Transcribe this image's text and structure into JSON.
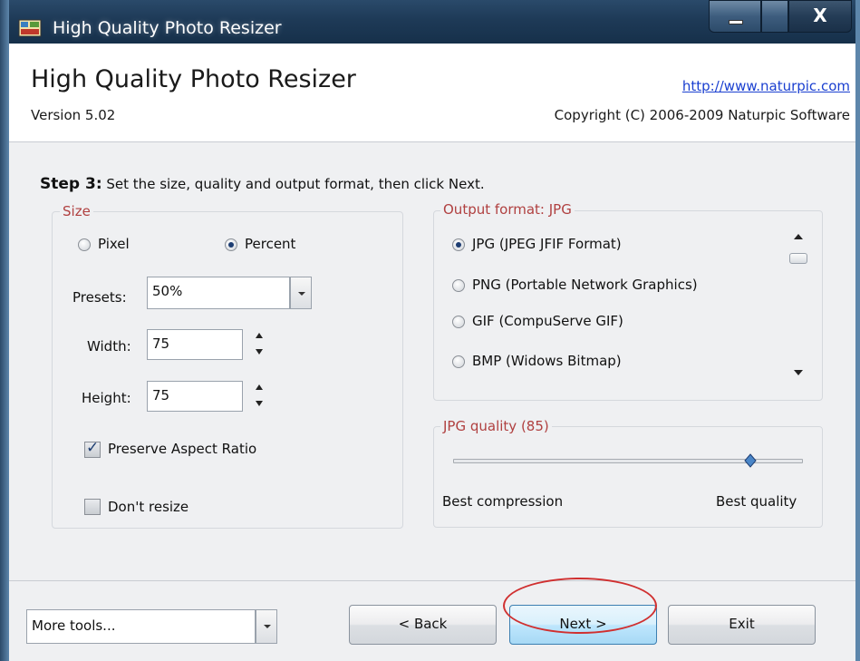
{
  "window": {
    "title": "High Quality Photo Resizer",
    "close_glyph": "X"
  },
  "header": {
    "app_title": "High Quality Photo Resizer",
    "version": "Version 5.02",
    "url": "http://www.naturpic.com",
    "copyright": "Copyright (C) 2006-2009 Naturpic Software"
  },
  "step": {
    "label": "Step 3:",
    "instruction": "Set the size, quality and output format, then click Next."
  },
  "size": {
    "legend": "Size",
    "unit_options": [
      {
        "label": "Pixel",
        "selected": false
      },
      {
        "label": "Percent",
        "selected": true
      }
    ],
    "presets_label": "Presets:",
    "presets_value": "50%",
    "width_label": "Width:",
    "width_value": "75",
    "height_label": "Height:",
    "height_value": "75",
    "preserve_label": "Preserve Aspect Ratio",
    "preserve_checked": true,
    "dont_resize_label": "Don't resize",
    "dont_resize_checked": false
  },
  "output_format": {
    "legend": "Output format: JPG",
    "options": [
      {
        "label": "JPG (JPEG JFIF Format)",
        "selected": true
      },
      {
        "label": "PNG (Portable Network Graphics)",
        "selected": false
      },
      {
        "label": "GIF (CompuServe GIF)",
        "selected": false
      },
      {
        "label": "BMP (Widows Bitmap)",
        "selected": false
      }
    ]
  },
  "quality": {
    "legend": "JPG quality (85)",
    "value": 85,
    "min_label": "Best compression",
    "max_label": "Best quality"
  },
  "footer": {
    "more_tools_value": "More tools...",
    "back_label": "< Back",
    "next_label": "Next >",
    "exit_label": "Exit"
  },
  "colors": {
    "legend_text": "#b04040",
    "link": "#1a3fd0",
    "annotation": "#d03030"
  }
}
